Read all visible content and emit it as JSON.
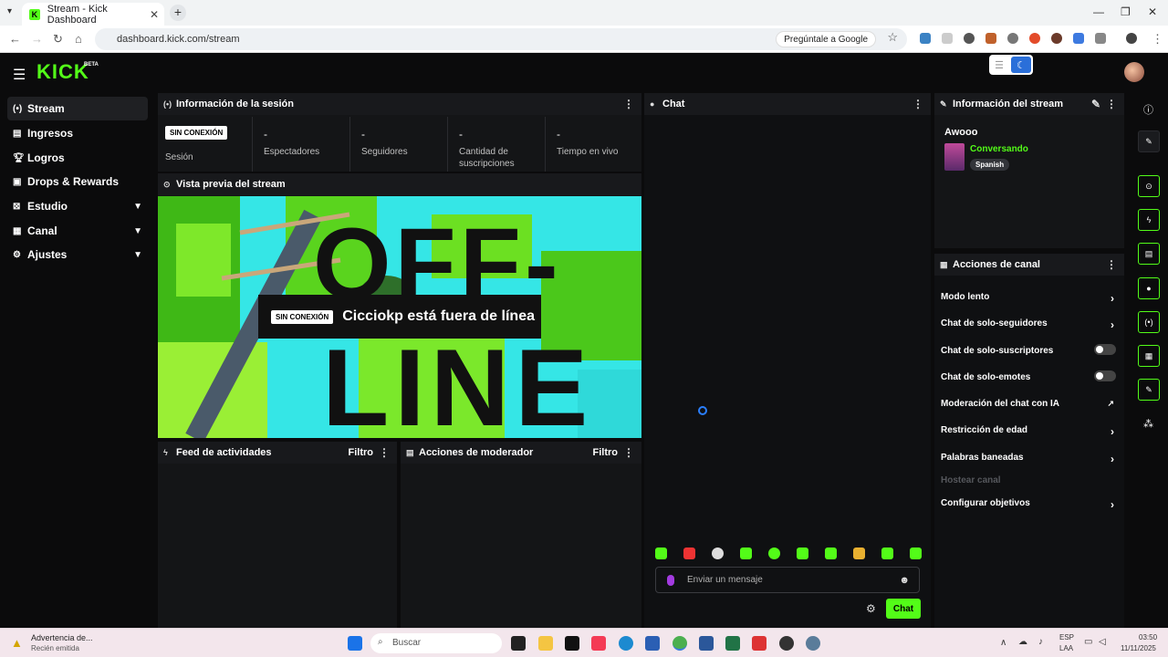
{
  "browser": {
    "tab_title": "Stream - Kick Dashboard",
    "tab_icon_letter": "K",
    "url": "dashboard.kick.com/stream",
    "google_button": "Pregúntale a Google"
  },
  "header": {
    "logo": "KICK",
    "beta": "BETA"
  },
  "sidebar": {
    "items": [
      {
        "label": "Stream",
        "icon": "stream-icon"
      },
      {
        "label": "Ingresos",
        "icon": "money-icon"
      },
      {
        "label": "Logros",
        "icon": "trophy-icon"
      },
      {
        "label": "Drops & Rewards",
        "icon": "gift-icon"
      },
      {
        "label": "Estudio",
        "icon": "studio-icon"
      },
      {
        "label": "Canal",
        "icon": "channel-icon"
      },
      {
        "label": "Ajustes",
        "icon": "gear-icon"
      }
    ]
  },
  "session": {
    "title": "Información de la sesión",
    "badge": "SIN CONEXIÓN",
    "session_label": "Sesión",
    "stats": [
      {
        "value": "-",
        "label": "Espectadores"
      },
      {
        "value": "-",
        "label": "Seguidores"
      },
      {
        "value": "-",
        "label": "Cantidad de suscripciones"
      },
      {
        "value": "-",
        "label": "Tiempo en vivo"
      }
    ]
  },
  "preview": {
    "title": "Vista previa del stream",
    "badge": "SIN CONEXIÓN",
    "message": "Cicciokp está fuera de línea",
    "big_text_top": "OFF-",
    "big_text_bottom": "LINE"
  },
  "feed": {
    "title": "Feed de actividades",
    "filter": "Filtro"
  },
  "mod": {
    "title": "Acciones de moderador",
    "filter": "Filtro"
  },
  "chat": {
    "title": "Chat",
    "placeholder": "Enviar un mensaje",
    "send": "Chat"
  },
  "stream_info": {
    "title": "Información del stream",
    "stream_title": "Awooo",
    "category": "Conversando",
    "language": "Spanish"
  },
  "channel_actions": {
    "title": "Acciones de canal",
    "items": [
      {
        "label": "Modo lento",
        "control": "arrow"
      },
      {
        "label": "Chat de solo-seguidores",
        "control": "arrow"
      },
      {
        "label": "Chat de solo-suscriptores",
        "control": "toggle"
      },
      {
        "label": "Chat de solo-emotes",
        "control": "toggle"
      },
      {
        "label": "Moderación del chat con IA",
        "control": "external"
      },
      {
        "label": "Restricción de edad",
        "control": "arrow"
      },
      {
        "label": "Palabras baneadas",
        "control": "arrow"
      },
      {
        "label": "Hostear canal",
        "control": "disabled"
      },
      {
        "label": "Configurar objetivos",
        "control": "arrow"
      }
    ]
  },
  "taskbar": {
    "notif_title": "Advertencia de...",
    "notif_sub": "Recién emitida",
    "search": "Buscar",
    "lang": "ESP",
    "lang2": "LAA",
    "time": "03:50",
    "date": "11/11/2025"
  },
  "colors": {
    "accent": "#53fc18",
    "bg": "#0b0b0c",
    "panel": "#141517"
  }
}
